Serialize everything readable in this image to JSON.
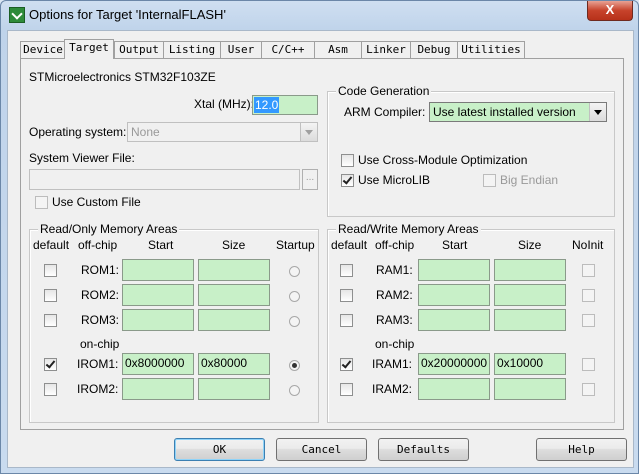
{
  "window": {
    "title": "Options for Target 'InternalFLASH'",
    "close_label": "X"
  },
  "tabs": [
    "Device",
    "Target",
    "Output",
    "Listing",
    "User",
    "C/C++",
    "Asm",
    "Linker",
    "Debug",
    "Utilities"
  ],
  "active_tab": "Target",
  "device_name": "STMicroelectronics STM32F103ZE",
  "xtal": {
    "label": "Xtal (MHz):",
    "value": "12.0"
  },
  "os": {
    "label": "Operating system:",
    "value": "None"
  },
  "svf": {
    "label": "System Viewer File:",
    "value": "",
    "browse_label": "...",
    "custom_label": "Use Custom File",
    "custom_checked": false
  },
  "codegen": {
    "title": "Code Generation",
    "compiler_label": "ARM Compiler:",
    "compiler_value": "Use latest installed version",
    "cross_module_label": "Use Cross-Module Optimization",
    "cross_module_checked": false,
    "microlib_label": "Use MicroLIB",
    "microlib_checked": true,
    "big_endian_label": "Big Endian",
    "big_endian_checked": false
  },
  "ro": {
    "title": "Read/Only Memory Areas",
    "headers": {
      "default": "default",
      "offchip": "off-chip",
      "start": "Start",
      "size": "Size",
      "last": "Startup"
    },
    "onchip_label": "on-chip",
    "rows": [
      {
        "name": "ROM1:",
        "default": false,
        "start": "",
        "size": "",
        "startup": false
      },
      {
        "name": "ROM2:",
        "default": false,
        "start": "",
        "size": "",
        "startup": false
      },
      {
        "name": "ROM3:",
        "default": false,
        "start": "",
        "size": "",
        "startup": false
      },
      {
        "name": "IROM1:",
        "default": true,
        "start": "0x8000000",
        "size": "0x80000",
        "startup": true
      },
      {
        "name": "IROM2:",
        "default": false,
        "start": "",
        "size": "",
        "startup": false
      }
    ]
  },
  "rw": {
    "title": "Read/Write Memory Areas",
    "headers": {
      "default": "default",
      "offchip": "off-chip",
      "start": "Start",
      "size": "Size",
      "last": "NoInit"
    },
    "onchip_label": "on-chip",
    "rows": [
      {
        "name": "RAM1:",
        "default": false,
        "start": "",
        "size": "",
        "noinit": false
      },
      {
        "name": "RAM2:",
        "default": false,
        "start": "",
        "size": "",
        "noinit": false
      },
      {
        "name": "RAM3:",
        "default": false,
        "start": "",
        "size": "",
        "noinit": false
      },
      {
        "name": "IRAM1:",
        "default": true,
        "start": "0x20000000",
        "size": "0x10000",
        "noinit": false
      },
      {
        "name": "IRAM2:",
        "default": false,
        "start": "",
        "size": "",
        "noinit": false
      }
    ]
  },
  "buttons": {
    "ok": "OK",
    "cancel": "Cancel",
    "defaults": "Defaults",
    "help": "Help"
  }
}
